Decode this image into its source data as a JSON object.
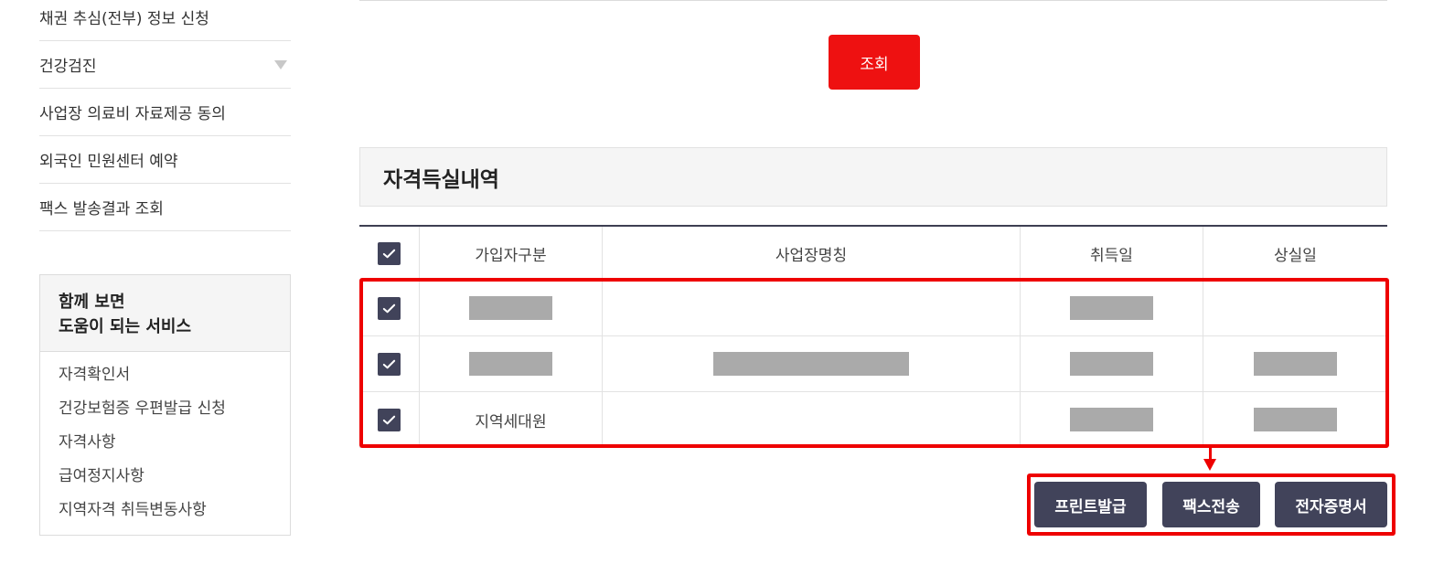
{
  "sidebar": {
    "menu": [
      {
        "label": "채권 추심(전부) 정보 신청"
      },
      {
        "label": "건강검진",
        "has_dropdown": true
      },
      {
        "label": "사업장 의료비 자료제공 동의"
      },
      {
        "label": "외국인 민원센터 예약"
      },
      {
        "label": "팩스 발송결과 조회"
      }
    ],
    "related": {
      "title_line1": "함께 보면",
      "title_line2": "도움이 되는 서비스",
      "links": [
        "자격확인서",
        "건강보험증 우편발급 신청",
        "자격사항",
        "급여정지사항",
        "지역자격 취득변동사항"
      ]
    }
  },
  "search_button": "조회",
  "section_title": "자격득실내역",
  "table": {
    "headers": [
      "가입자구분",
      "사업장명칭",
      "취득일",
      "상실일"
    ],
    "rows": [
      {
        "checked": true,
        "type": "",
        "type_redacted": true,
        "name_redacted": false,
        "acq_redacted": true,
        "loss_redacted": false
      },
      {
        "checked": true,
        "type": "",
        "type_redacted": true,
        "name_redacted": true,
        "acq_redacted": true,
        "loss_redacted": true
      },
      {
        "checked": true,
        "type": "지역세대원",
        "type_redacted": false,
        "name_redacted": false,
        "acq_redacted": true,
        "loss_redacted": true
      }
    ]
  },
  "actions": {
    "print": "프린트발급",
    "fax": "팩스전송",
    "ecert": "전자증명서"
  },
  "colors": {
    "accent_red": "#ee1111",
    "dark_button": "#41435a",
    "highlight_frame": "#ee0000"
  }
}
